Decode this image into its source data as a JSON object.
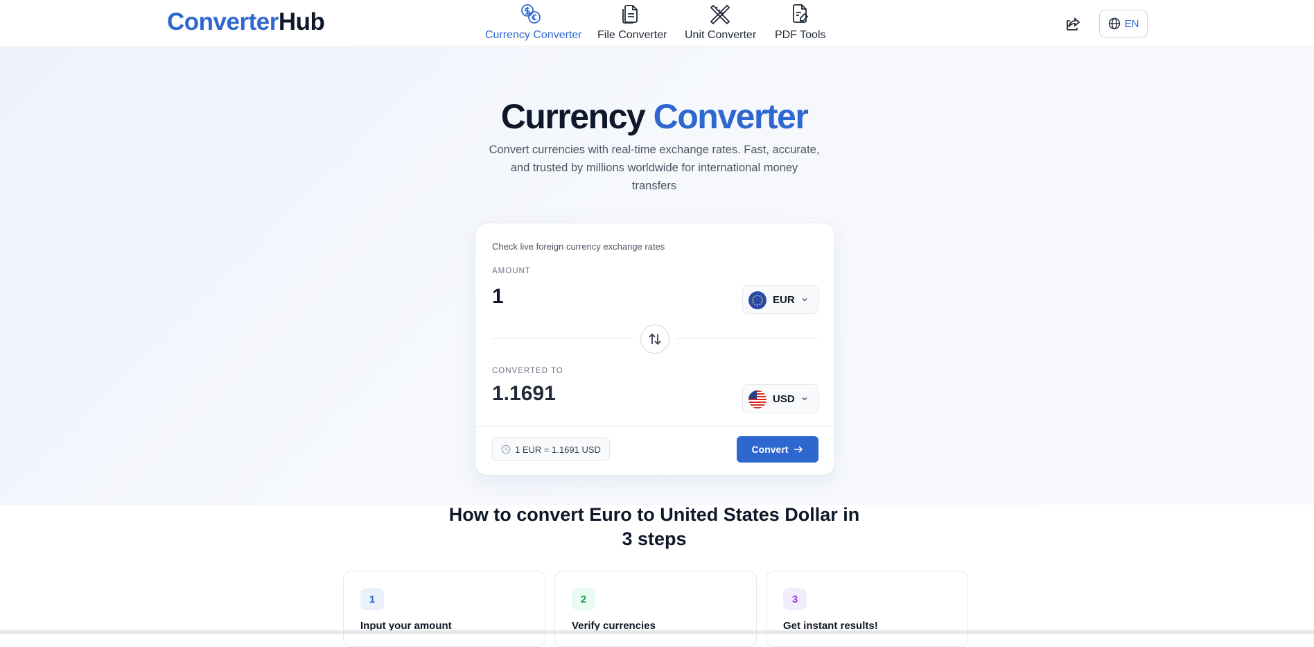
{
  "header": {
    "logo": {
      "part_blue": "Converter",
      "part_dark": "Hub"
    },
    "nav": [
      {
        "label": "Currency Converter",
        "icon": "coins-icon",
        "active": true
      },
      {
        "label": "File Converter",
        "icon": "file-icon",
        "active": false
      },
      {
        "label": "Unit Converter",
        "icon": "ruler-icon",
        "active": false
      },
      {
        "label": "PDF Tools",
        "icon": "pdf-edit-icon",
        "active": false
      }
    ],
    "share_icon": "share-icon",
    "language": {
      "label": "EN",
      "icon": "globe-icon"
    }
  },
  "hero": {
    "title_dark": "Currency",
    "title_blue": "Converter",
    "subtitle": "Convert currencies with real-time exchange rates. Fast, accurate, and trusted by millions worldwide for international money transfers"
  },
  "converter": {
    "hint": "Check live foreign currency exchange rates",
    "amount_label": "AMOUNT",
    "amount_value": "1",
    "from_currency": {
      "code": "EUR",
      "flag": "eu-flag-icon"
    },
    "swap_icon": "swap-arrows-icon",
    "converted_label": "CONVERTED TO",
    "converted_value": "1.1691",
    "to_currency": {
      "code": "USD",
      "flag": "us-flag-icon"
    },
    "rate_text": "1 EUR = 1.1691 USD",
    "convert_label": "Convert"
  },
  "steps": {
    "title": "How to convert Euro to United States Dollar in 3 steps",
    "items": [
      {
        "number": "1",
        "title": "Input your amount"
      },
      {
        "number": "2",
        "title": "Verify currencies"
      },
      {
        "number": "3",
        "title": "Get instant results!"
      }
    ]
  },
  "colors": {
    "accent": "#2f67d0",
    "step1": "#eaf1fd",
    "step2": "#eafbf1",
    "step3": "#f3ecfd"
  }
}
